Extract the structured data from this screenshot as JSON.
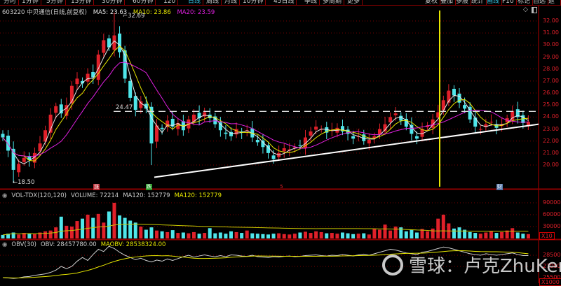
{
  "menu": {
    "left": [
      "分时",
      "1分钟",
      "5分钟",
      "15分钟",
      "30分钟",
      "60分钟",
      "120",
      "日线",
      "周线",
      "月线",
      "10分钟",
      "45日线",
      "季线",
      "多周期",
      "更多"
    ],
    "active": "日线",
    "right": [
      "复权",
      "叠加",
      "多股",
      "统计",
      "画线",
      "F10",
      "标记",
      "自选",
      "返回"
    ],
    "right_active": "画线"
  },
  "header": {
    "stock": "603220 中贝通信(日线,前复权)",
    "ma5": "MA5: 23.63",
    "ma10": "MA10: 23.86",
    "ma20": "MA20: 23.59"
  },
  "annotations": {
    "high": "32.69",
    "low": "18.50",
    "resistance": "24.47"
  },
  "markers": [
    "涨",
    "跌",
    "5",
    "财"
  ],
  "colors": {
    "up": "#e0202a",
    "down": "#4fe6ea",
    "ma5": "#e8e8e8",
    "ma10": "#e6e600",
    "ma20": "#e020e0",
    "grid": "#7a0000"
  },
  "price_axis": [
    "32.00",
    "31.00",
    "30.00",
    "29.00",
    "28.00",
    "27.00",
    "26.00",
    "25.00",
    "24.00",
    "23.00",
    "22.00",
    "21.00",
    "20.00"
  ],
  "volume": {
    "header": "VOL-TDX(120,120)",
    "volume": "VOLUME: 72214",
    "ma120a": "MA120: 152779",
    "ma120b": "MA120: 152779",
    "axis": [
      "90000",
      "60000",
      "30000"
    ],
    "unit": "X10"
  },
  "obv": {
    "header": "OBV(30)",
    "obv": "OBV: 28457780.00",
    "maobv": "MAOBV: 28538324.00",
    "axis": [
      "28500",
      "27000",
      "25500"
    ],
    "unit": "X1000"
  },
  "watermark": "雪球：卢克ZhuKer",
  "chart_data": {
    "type": "candlestick",
    "closes": [
      22.3,
      21.2,
      19.6,
      20.1,
      20.6,
      20.4,
      21.0,
      21.8,
      22.9,
      24.2,
      24.9,
      24.3,
      25.0,
      26.6,
      27.2,
      26.8,
      27.6,
      27.3,
      29.2,
      30.4,
      29.8,
      30.8,
      29.4,
      27.2,
      25.6,
      24.6,
      25.3,
      24.7,
      21.8,
      23.3,
      23.0,
      23.7,
      23.2,
      23.5,
      22.9,
      23.8,
      24.2,
      23.9,
      24.4,
      23.9,
      23.4,
      22.9,
      22.6,
      22.4,
      23.0,
      22.7,
      22.9,
      22.3,
      21.9,
      21.5,
      21.0,
      20.5,
      21.0,
      21.4,
      21.3,
      21.5,
      21.6,
      22.3,
      22.8,
      23.2,
      23.0,
      22.7,
      22.9,
      23.1,
      22.8,
      22.6,
      22.2,
      22.4,
      22.0,
      22.1,
      22.4,
      23.0,
      23.4,
      24.0,
      24.3,
      23.7,
      23.2,
      22.6,
      22.2,
      23.0,
      23.3,
      23.8,
      24.4,
      25.4,
      26.2,
      25.8,
      25.2,
      24.7,
      23.8,
      23.2,
      23.0,
      23.4,
      23.6,
      23.1,
      23.4,
      23.9,
      24.5,
      24.0,
      23.5,
      23.6
    ],
    "volumes": [
      9000,
      12000,
      15000,
      10000,
      14000,
      13000,
      11000,
      15000,
      18000,
      20000,
      28000,
      55000,
      32000,
      30000,
      44000,
      50000,
      60000,
      52000,
      62000,
      40000,
      68000,
      90000,
      58000,
      52000,
      45000,
      40000,
      30000,
      22000,
      28000,
      20000,
      18000,
      16000,
      21000,
      14000,
      15000,
      13000,
      16000,
      12000,
      14000,
      26000,
      13000,
      15000,
      12000,
      18000,
      16000,
      14000,
      20000,
      13000,
      12000,
      11000,
      10000,
      12000,
      13000,
      11000,
      10000,
      12000,
      15000,
      17000,
      14000,
      18000,
      16000,
      13000,
      14000,
      12000,
      15000,
      13000,
      11000,
      12000,
      13000,
      10000,
      25000,
      22000,
      35000,
      20000,
      30000,
      28000,
      18000,
      22000,
      15000,
      24000,
      18000,
      25000,
      50000,
      60000,
      38000,
      25000,
      28000,
      22000,
      16000,
      14000,
      12000,
      15000,
      18000,
      14000,
      16000,
      20000,
      26000,
      15000,
      12000,
      11000
    ],
    "obv": [
      25500,
      25450,
      25400,
      25450,
      25600,
      25650,
      25800,
      25900,
      26000,
      26200,
      26500,
      27000,
      26700,
      27000,
      27700,
      28200,
      27800,
      28600,
      29300,
      29000,
      29700,
      29400,
      28900,
      28500,
      28200,
      27900,
      28100,
      27800,
      27600,
      27850,
      27700,
      28000,
      27800,
      28050,
      28300,
      28500,
      28250,
      28400,
      28550,
      28400,
      28300,
      28450,
      28300,
      28550,
      28500,
      28400,
      28350,
      28500,
      28300,
      28250,
      28200,
      28300,
      28250,
      28350,
      28400,
      28300,
      28350,
      28450,
      28500,
      28550,
      28450,
      28400,
      28500,
      28450,
      28600,
      28500,
      28400,
      28550,
      28650,
      28500,
      28700,
      28900,
      29100,
      29300,
      29200,
      29000,
      28800,
      28700,
      28600,
      28900,
      29000,
      29200,
      29400,
      29600,
      29500,
      29300,
      29100,
      28900,
      28700,
      28600,
      28500,
      28700,
      28600,
      28500,
      28600,
      28700,
      28800,
      28600,
      28450,
      28458
    ],
    "y_range": [
      18.5,
      32.69
    ],
    "levels": {
      "resistance": 24.47,
      "trendline_from": 19.8,
      "trendline_to": 23.4
    }
  }
}
